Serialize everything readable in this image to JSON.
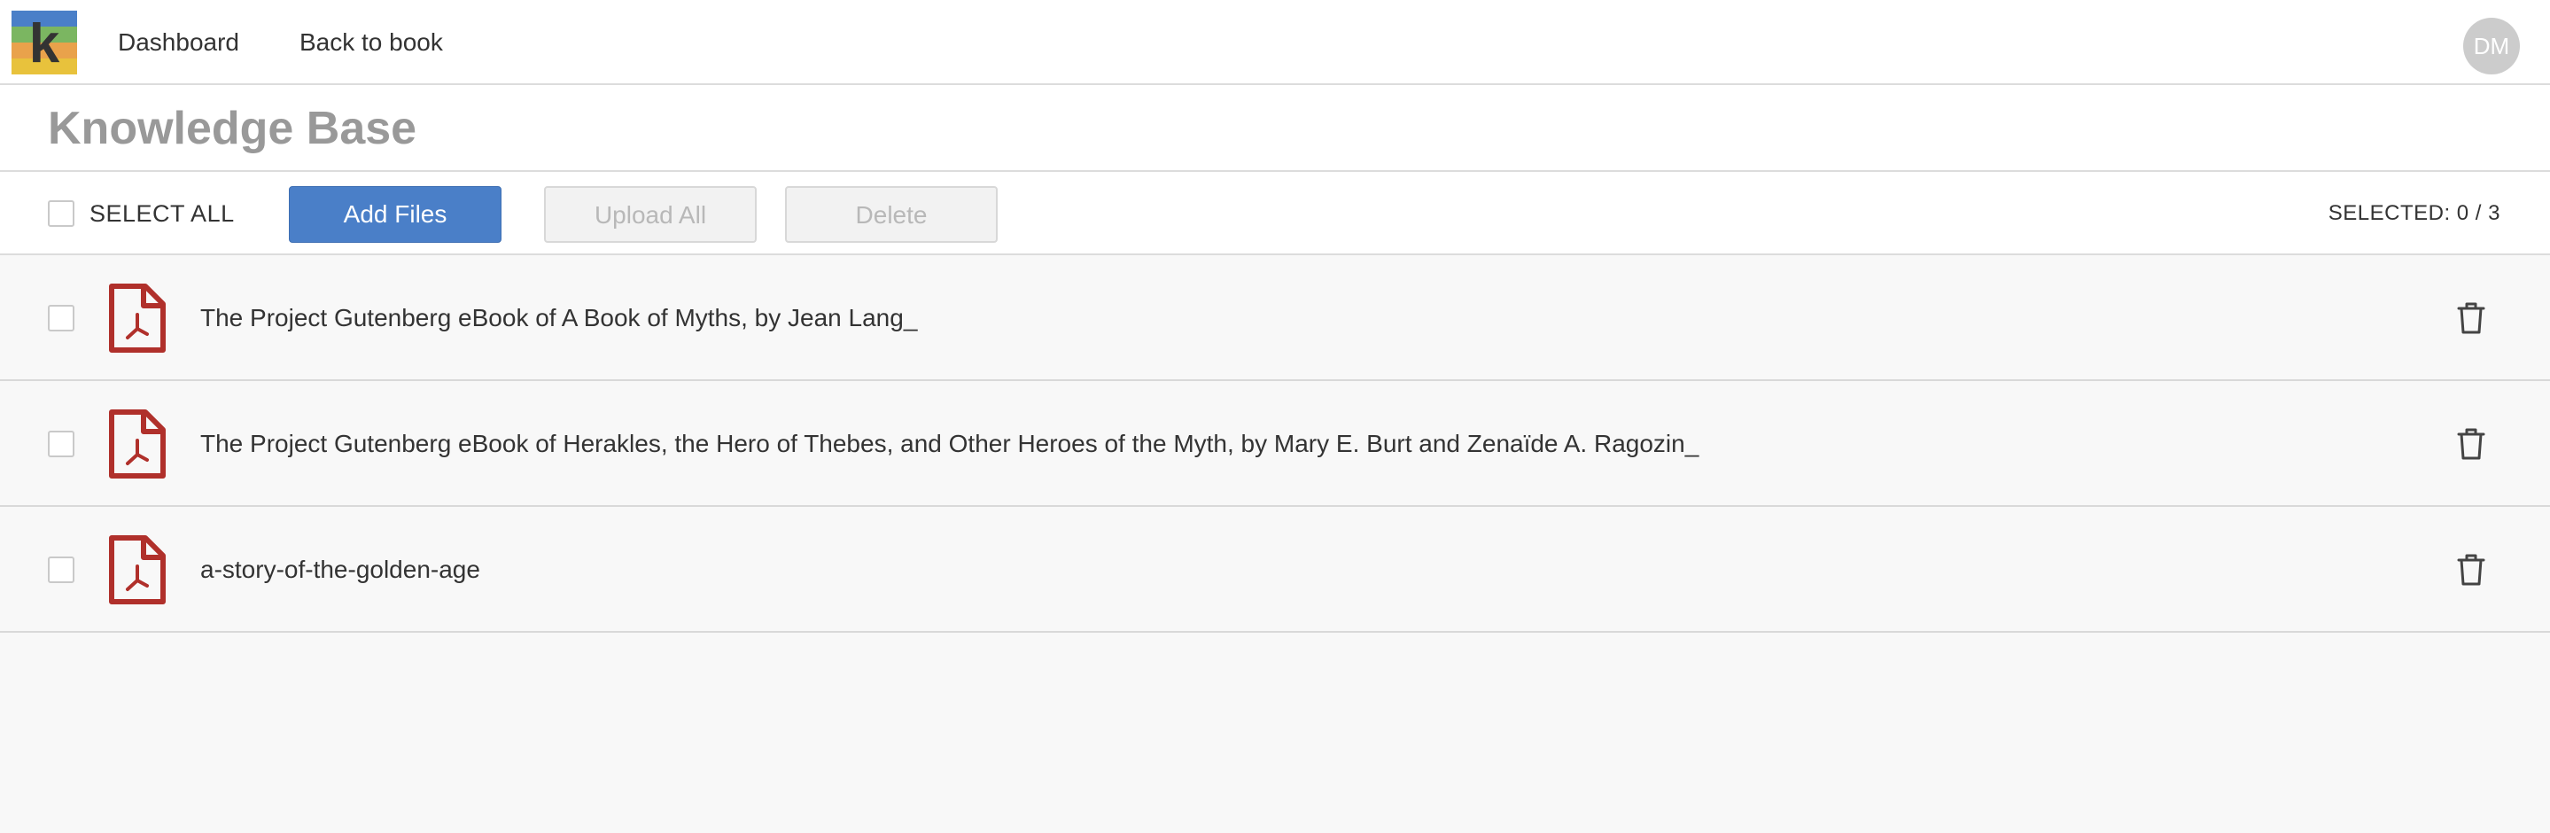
{
  "nav": {
    "logo_letter": "k",
    "links": [
      "Dashboard",
      "Back to book"
    ],
    "user_initials": "DM",
    "logo_colors": [
      "#4a7fc8",
      "#7bb661",
      "#e9a24b",
      "#e8c23c"
    ]
  },
  "page": {
    "title": "Knowledge Base"
  },
  "toolbar": {
    "select_all_label": "SELECT ALL",
    "add_files_label": "Add Files",
    "upload_all_label": "Upload All",
    "delete_label": "Delete",
    "selected_count": "SELECTED: 0 / 3"
  },
  "files": [
    {
      "name": "The Project Gutenberg eBook of A Book of Myths, by Jean Lang_",
      "type": "pdf-icon",
      "checked": false
    },
    {
      "name": "The Project Gutenberg eBook of Herakles, the Hero of Thebes, and Other Heroes of the Myth, by Mary E. Burt and Zenaïde A. Ragozin_",
      "type": "pdf-icon",
      "checked": false
    },
    {
      "name": "a-story-of-the-golden-age",
      "type": "pdf-icon",
      "checked": false
    }
  ],
  "colors": {
    "accent": "#4a7fc8",
    "pdf_red": "#b0302b",
    "title_gray": "#999999"
  }
}
